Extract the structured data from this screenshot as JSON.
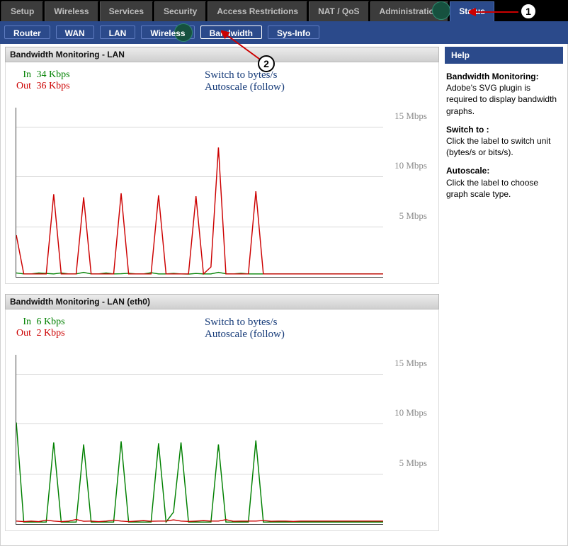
{
  "top_tabs": {
    "setup": "Setup",
    "wireless": "Wireless",
    "services": "Services",
    "security": "Security",
    "access": "Access Restrictions",
    "natqos": "NAT / QoS",
    "admin": "Administration",
    "status": "Status"
  },
  "sub_tabs": {
    "router": "Router",
    "wan": "WAN",
    "lan": "LAN",
    "wireless": "Wireless",
    "bandwidth": "Bandwidth",
    "sysinfo": "Sys-Info"
  },
  "panels": {
    "lan": {
      "title": "Bandwidth Monitoring - LAN",
      "in_label": "In",
      "in_value": "34 Kbps",
      "out_label": "Out",
      "out_value": "36 Kbps",
      "switch": "Switch to bytes/s",
      "autoscale": "Autoscale (follow)"
    },
    "eth0": {
      "title": "Bandwidth Monitoring - LAN (eth0)",
      "in_label": "In",
      "in_value": "6 Kbps",
      "out_label": "Out",
      "out_value": "2 Kbps",
      "switch": "Switch to bytes/s",
      "autoscale": "Autoscale (follow)"
    }
  },
  "axis_labels": {
    "l15": "15 Mbps",
    "l10": "10 Mbps",
    "l5": "5 Mbps"
  },
  "help": {
    "title": "Help",
    "bm_h": "Bandwidth Monitoring:",
    "bm_t": "Adobe's SVG plugin is required to display bandwidth graphs.",
    "sw_h": "Switch to :",
    "sw_t": "Click the label to switch unit (bytes/s or bits/s).",
    "as_h": "Autoscale:",
    "as_t": "Click the label to choose graph scale type."
  },
  "callouts": {
    "1": "1",
    "2": "2"
  },
  "chart_data": [
    {
      "name": "LAN",
      "type": "line",
      "ylabel": "Mbps",
      "ylim": [
        0,
        17
      ],
      "grid": [
        5,
        10,
        15
      ],
      "series": [
        {
          "name": "In",
          "color": "#008000",
          "values": [
            0.4,
            0.3,
            0.3,
            0.4,
            0.35,
            0.3,
            0.4,
            0.3,
            0.3,
            0.45,
            0.3,
            0.3,
            0.4,
            0.3,
            0.32,
            0.36,
            0.3,
            0.3,
            0.42,
            0.3,
            0.3,
            0.35,
            0.3,
            0.28,
            0.34,
            0.3,
            0.3,
            0.46,
            0.32,
            0.3,
            0.36,
            0.3,
            0.3,
            0.3,
            0.3,
            0.3,
            0.3,
            0.3,
            0.3,
            0.3,
            0.3,
            0.3,
            0.3,
            0.3,
            0.3,
            0.3,
            0.3,
            0.3,
            0.3,
            0.3
          ]
        },
        {
          "name": "Out",
          "color": "#cc0000",
          "values": [
            4.2,
            0.3,
            0.3,
            0.3,
            0.3,
            8.3,
            0.3,
            0.3,
            0.3,
            8.0,
            0.3,
            0.3,
            0.3,
            0.3,
            8.4,
            0.3,
            0.3,
            0.3,
            0.3,
            8.2,
            0.3,
            0.3,
            0.3,
            0.3,
            8.1,
            0.3,
            1.0,
            13.0,
            0.3,
            0.3,
            0.3,
            0.3,
            8.6,
            0.3,
            0.3,
            0.3,
            0.3,
            0.3,
            0.3,
            0.3,
            0.3,
            0.3,
            0.3,
            0.3,
            0.3,
            0.3,
            0.3,
            0.3,
            0.3,
            0.3
          ]
        }
      ]
    },
    {
      "name": "LAN (eth0)",
      "type": "line",
      "ylabel": "Mbps",
      "ylim": [
        0,
        17
      ],
      "grid": [
        5,
        10,
        15
      ],
      "series": [
        {
          "name": "In",
          "color": "#008000",
          "values": [
            10.2,
            0.2,
            0.2,
            0.2,
            0.2,
            8.2,
            0.2,
            0.2,
            0.2,
            8.0,
            0.2,
            0.2,
            0.2,
            0.2,
            8.3,
            0.2,
            0.2,
            0.2,
            0.2,
            8.1,
            0.2,
            1.2,
            8.2,
            0.2,
            0.2,
            0.2,
            0.2,
            8.0,
            0.2,
            0.2,
            0.2,
            0.2,
            8.4,
            0.2,
            0.2,
            0.2,
            0.2,
            0.2,
            0.2,
            0.2,
            0.2,
            0.2,
            0.2,
            0.2,
            0.2,
            0.2,
            0.2,
            0.2,
            0.2,
            0.2
          ]
        },
        {
          "name": "Out",
          "color": "#cc0000",
          "values": [
            0.3,
            0.25,
            0.3,
            0.25,
            0.4,
            0.3,
            0.25,
            0.3,
            0.45,
            0.28,
            0.3,
            0.25,
            0.3,
            0.4,
            0.3,
            0.25,
            0.3,
            0.35,
            0.28,
            0.3,
            0.3,
            0.42,
            0.3,
            0.26,
            0.3,
            0.35,
            0.3,
            0.3,
            0.44,
            0.28,
            0.3,
            0.3,
            0.3,
            0.36,
            0.28,
            0.3,
            0.3,
            0.26,
            0.3,
            0.3,
            0.3,
            0.3,
            0.3,
            0.3,
            0.3,
            0.3,
            0.3,
            0.3,
            0.3,
            0.3
          ]
        }
      ]
    }
  ]
}
